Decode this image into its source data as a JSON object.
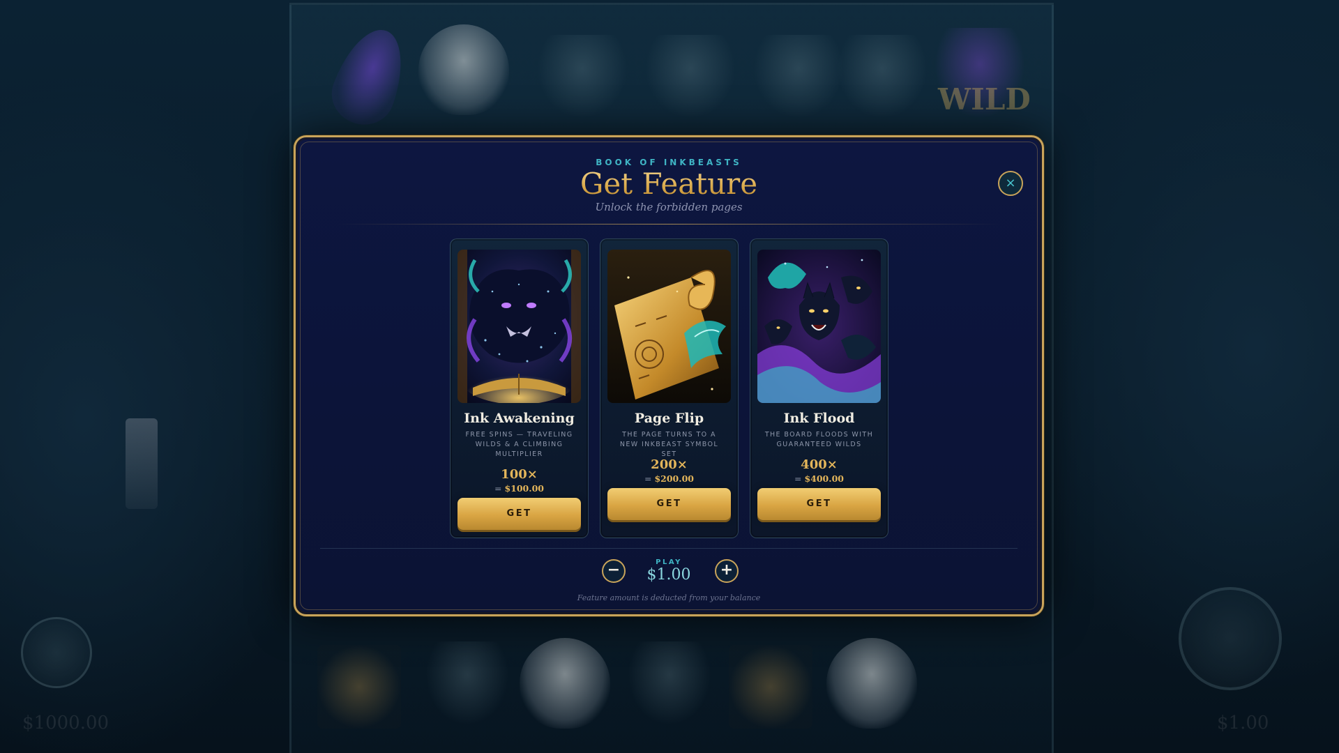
{
  "background": {
    "wild_label": "WILD",
    "balance": "$1000.00",
    "bet": "$1.00"
  },
  "modal": {
    "eyebrow": "BOOK OF INKBEASTS",
    "title": "Get Feature",
    "subtitle": "Unlock the forbidden pages",
    "close_label": "×",
    "close_icon": "close-icon"
  },
  "features": [
    {
      "name": "Ink Awakening",
      "description": "FREE SPINS — TRAVELING WILDS & A CLIMBING MULTIPLIER",
      "multiplier": "100×",
      "cost": "$100.00",
      "button": "GET",
      "art": "ink-beast-book-art"
    },
    {
      "name": "Page Flip",
      "description": "THE PAGE TURNS TO A NEW INKBEAST SYMBOL SET",
      "multiplier": "200×",
      "cost": "$200.00",
      "button": "GET",
      "art": "golden-scroll-art"
    },
    {
      "name": "Ink Flood",
      "description": "THE BOARD FLOODS WITH GUARANTEED WILDS",
      "multiplier": "400×",
      "cost": "$400.00",
      "button": "GET",
      "art": "ink-wolves-flood-art"
    }
  ],
  "bet": {
    "label": "PLAY",
    "value": "$1.00",
    "minus": "−",
    "plus": "+",
    "footnote": "Feature amount is deducted from your balance"
  },
  "colors": {
    "gold": "#c9a45a",
    "teal": "#3fb4c4",
    "modal_bg": "#0d1640"
  }
}
